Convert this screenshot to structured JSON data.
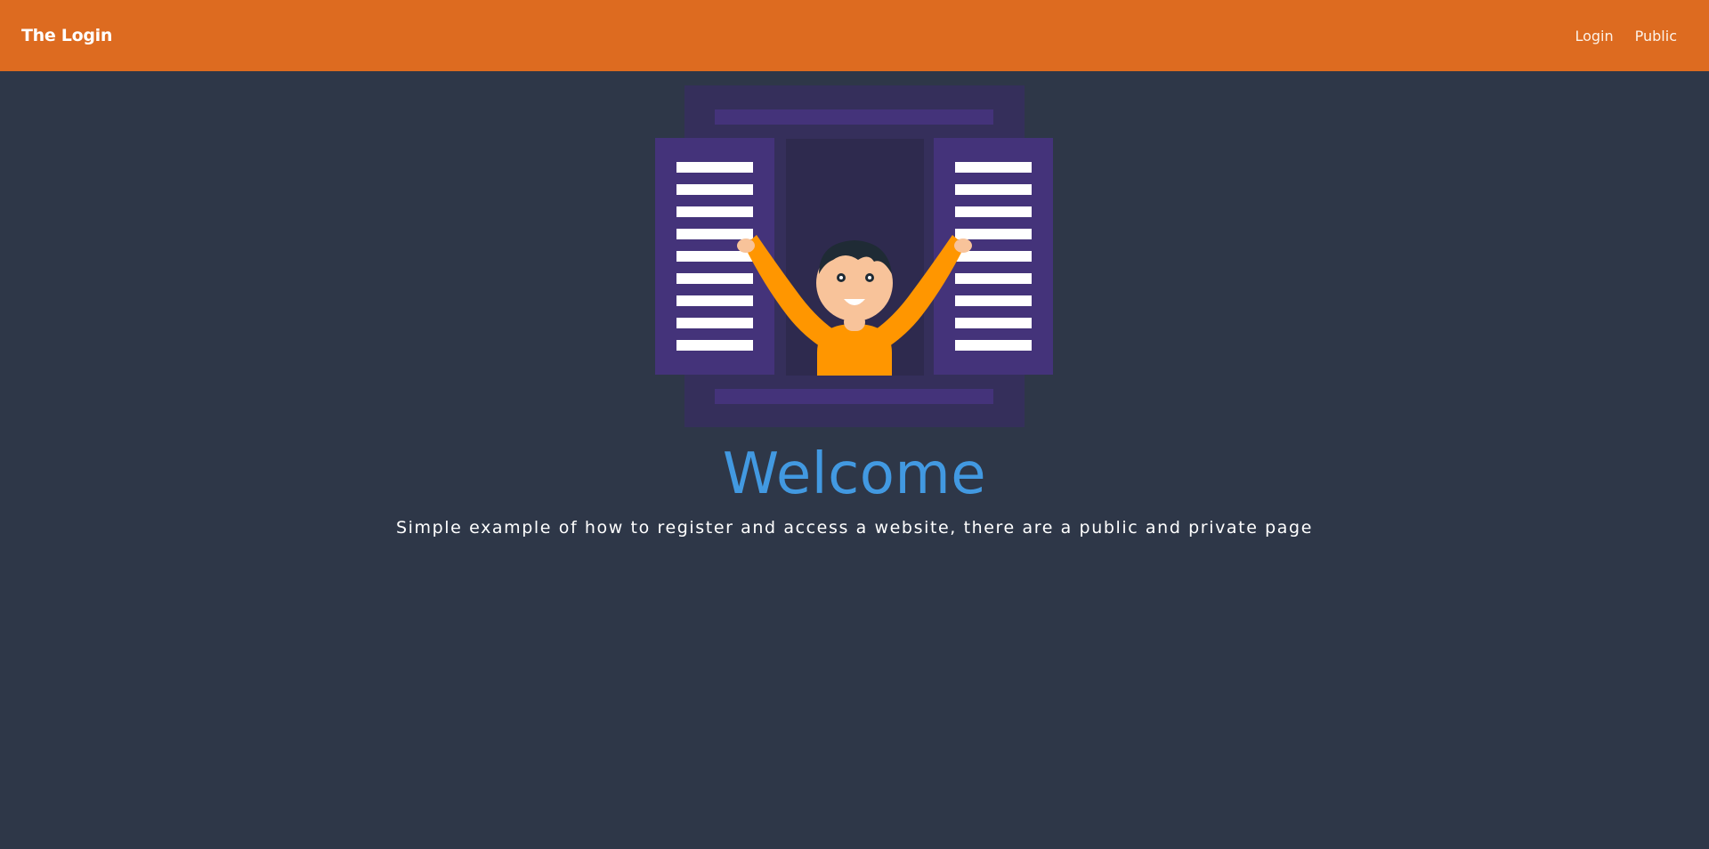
{
  "navbar": {
    "brand": "The Login",
    "links": [
      {
        "label": "Login"
      },
      {
        "label": "Public"
      }
    ],
    "color": "#dd6b20"
  },
  "hero": {
    "title": "Welcome",
    "subtitle": "Simple example of how to register and access a website, there are a public and private page",
    "title_color": "#4299e1",
    "illustration": "person-at-window-illustration"
  },
  "colors": {
    "background": "#2e3748",
    "shutter": "#44337a",
    "window_frame": "#352f5b",
    "shirt": "#ff9600",
    "skin": "#f8c39a"
  }
}
